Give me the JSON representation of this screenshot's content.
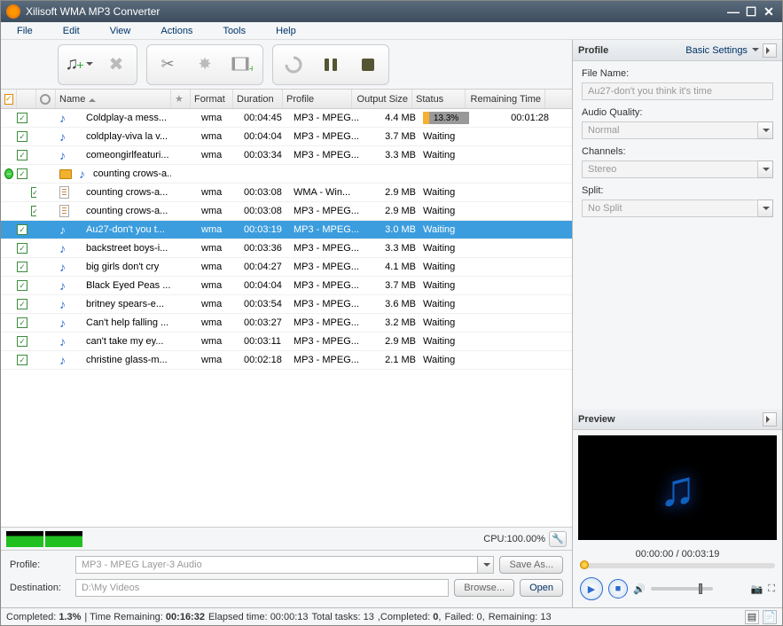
{
  "window": {
    "title": "Xilisoft WMA MP3 Converter"
  },
  "menu": [
    "File",
    "Edit",
    "View",
    "Actions",
    "Tools",
    "Help"
  ],
  "columns": {
    "name": "Name",
    "format": "Format",
    "duration": "Duration",
    "profile": "Profile",
    "output_size": "Output Size",
    "status": "Status",
    "remaining": "Remaining Time"
  },
  "rows": [
    {
      "indent": 0,
      "icon": "music",
      "name": "Coldplay-a mess...",
      "format": "wma",
      "duration": "00:04:45",
      "profile": "MP3 - MPEG...",
      "size": "4.4 MB",
      "status_type": "progress",
      "status": "13.3%",
      "remaining": "00:01:28"
    },
    {
      "indent": 0,
      "icon": "music",
      "name": "coldplay-viva la v...",
      "format": "wma",
      "duration": "00:04:04",
      "profile": "MP3 - MPEG...",
      "size": "3.7 MB",
      "status": "Waiting",
      "remaining": ""
    },
    {
      "indent": 0,
      "icon": "music",
      "name": "comeongirlfeaturi...",
      "format": "wma",
      "duration": "00:03:34",
      "profile": "MP3 - MPEG...",
      "size": "3.3 MB",
      "status": "Waiting",
      "remaining": ""
    },
    {
      "indent": 0,
      "expander": "minus",
      "icon": "folder",
      "iconb": "music",
      "name": "counting crows-a...",
      "format": "",
      "duration": "",
      "profile": "",
      "size": "",
      "status": "",
      "remaining": ""
    },
    {
      "indent": 1,
      "icon": "doc",
      "name": "counting crows-a...",
      "format": "wma",
      "duration": "00:03:08",
      "profile": "WMA - Win...",
      "size": "2.9 MB",
      "status": "Waiting",
      "remaining": ""
    },
    {
      "indent": 1,
      "icon": "doc",
      "name": "counting crows-a...",
      "format": "wma",
      "duration": "00:03:08",
      "profile": "MP3 - MPEG...",
      "size": "2.9 MB",
      "status": "Waiting",
      "remaining": ""
    },
    {
      "indent": 0,
      "selected": true,
      "icon": "music",
      "name": "Au27-don't you t...",
      "format": "wma",
      "duration": "00:03:19",
      "profile": "MP3 - MPEG...",
      "size": "3.0 MB",
      "status": "Waiting",
      "remaining": ""
    },
    {
      "indent": 0,
      "icon": "music",
      "name": "backstreet boys-i...",
      "format": "wma",
      "duration": "00:03:36",
      "profile": "MP3 - MPEG...",
      "size": "3.3 MB",
      "status": "Waiting",
      "remaining": ""
    },
    {
      "indent": 0,
      "icon": "music",
      "name": "big girls don't cry",
      "format": "wma",
      "duration": "00:04:27",
      "profile": "MP3 - MPEG...",
      "size": "4.1 MB",
      "status": "Waiting",
      "remaining": ""
    },
    {
      "indent": 0,
      "icon": "music",
      "name": "Black Eyed Peas ...",
      "format": "wma",
      "duration": "00:04:04",
      "profile": "MP3 - MPEG...",
      "size": "3.7 MB",
      "status": "Waiting",
      "remaining": ""
    },
    {
      "indent": 0,
      "icon": "music",
      "name": "britney spears-e...",
      "format": "wma",
      "duration": "00:03:54",
      "profile": "MP3 - MPEG...",
      "size": "3.6 MB",
      "status": "Waiting",
      "remaining": ""
    },
    {
      "indent": 0,
      "icon": "music",
      "name": "Can't help falling ...",
      "format": "wma",
      "duration": "00:03:27",
      "profile": "MP3 - MPEG...",
      "size": "3.2 MB",
      "status": "Waiting",
      "remaining": ""
    },
    {
      "indent": 0,
      "icon": "music",
      "name": "can't take my ey...",
      "format": "wma",
      "duration": "00:03:11",
      "profile": "MP3 - MPEG...",
      "size": "2.9 MB",
      "status": "Waiting",
      "remaining": ""
    },
    {
      "indent": 0,
      "icon": "music",
      "name": "christine glass-m...",
      "format": "wma",
      "duration": "00:02:18",
      "profile": "MP3 - MPEG...",
      "size": "2.1 MB",
      "status": "Waiting",
      "remaining": ""
    }
  ],
  "cpu": "CPU:100.00%",
  "bottom": {
    "profile_label": "Profile:",
    "profile_value": "MP3 - MPEG Layer-3 Audio",
    "saveas": "Save As...",
    "dest_label": "Destination:",
    "dest_value": "D:\\My Videos",
    "browse": "Browse...",
    "open": "Open"
  },
  "status": {
    "completed_lbl": "Completed:",
    "completed": "1.3%",
    "time_rem_lbl": "Time Remaining:",
    "time_rem": "00:16:32",
    "elapsed_lbl": "Elapsed time:",
    "elapsed": "00:00:13",
    "total_lbl": "Total tasks:",
    "total": "13",
    "comp2_lbl": "Completed:",
    "comp2": "0",
    "failed_lbl": "Failed:",
    "failed": "0",
    "rem_lbl": "Remaining:",
    "rem": "13"
  },
  "profile_panel": {
    "title": "Profile",
    "link": "Basic Settings",
    "filename_lbl": "File Name:",
    "filename": "Au27-don't you think it's time",
    "quality_lbl": "Audio Quality:",
    "quality": "Normal",
    "channels_lbl": "Channels:",
    "channels": "Stereo",
    "split_lbl": "Split:",
    "split": "No Split"
  },
  "preview": {
    "title": "Preview",
    "time": "00:00:00 / 00:03:19"
  }
}
